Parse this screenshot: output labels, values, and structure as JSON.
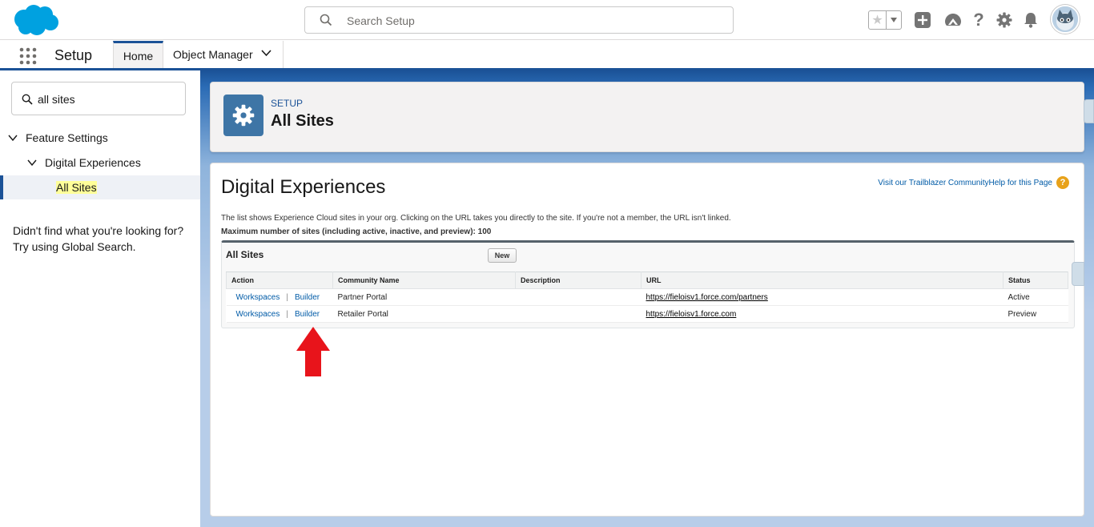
{
  "header": {
    "search_placeholder": "Search Setup",
    "icons": [
      "favorites-star-icon",
      "add-icon",
      "trailhead-icon",
      "help-icon",
      "gear-icon",
      "bell-icon",
      "avatar"
    ]
  },
  "nav": {
    "app_name": "Setup",
    "tabs": [
      {
        "label": "Home"
      },
      {
        "label": "Object Manager"
      }
    ]
  },
  "sidebar": {
    "quick_find_value": "all sites",
    "tree": {
      "level1": "Feature Settings",
      "level2": "Digital Experiences",
      "level3": "All Sites"
    },
    "not_found_text": "Didn't find what you're looking for? Try using Global Search."
  },
  "page_header": {
    "breadcrumb": "SETUP",
    "title": "All Sites"
  },
  "main": {
    "title": "Digital Experiences",
    "help_link_1": "Visit our Trailblazer Community",
    "help_link_2": "Help for this Page",
    "description": "The list shows Experience Cloud sites in your org. Clicking on the URL takes you directly to the site. If you're not a member, the URL isn't linked.",
    "max_sites": "Maximum number of sites (including active, inactive, and preview): 100",
    "list": {
      "title": "All Sites",
      "new_button": "New",
      "columns": [
        "Action",
        "Community Name",
        "Description",
        "URL",
        "Status"
      ],
      "rows": [
        {
          "action1": "Workspaces",
          "action2": "Builder",
          "name": "Partner Portal",
          "description": "",
          "url": "https://fieloisv1.force.com/partners",
          "status": "Active"
        },
        {
          "action1": "Workspaces",
          "action2": "Builder",
          "name": "Retailer Portal",
          "description": "",
          "url": "https://fieloisv1.force.com",
          "status": "Preview"
        }
      ]
    }
  },
  "colors": {
    "brand_blue": "#1b5297",
    "link_blue": "#015ba7",
    "arrow_red": "#e8141b"
  }
}
